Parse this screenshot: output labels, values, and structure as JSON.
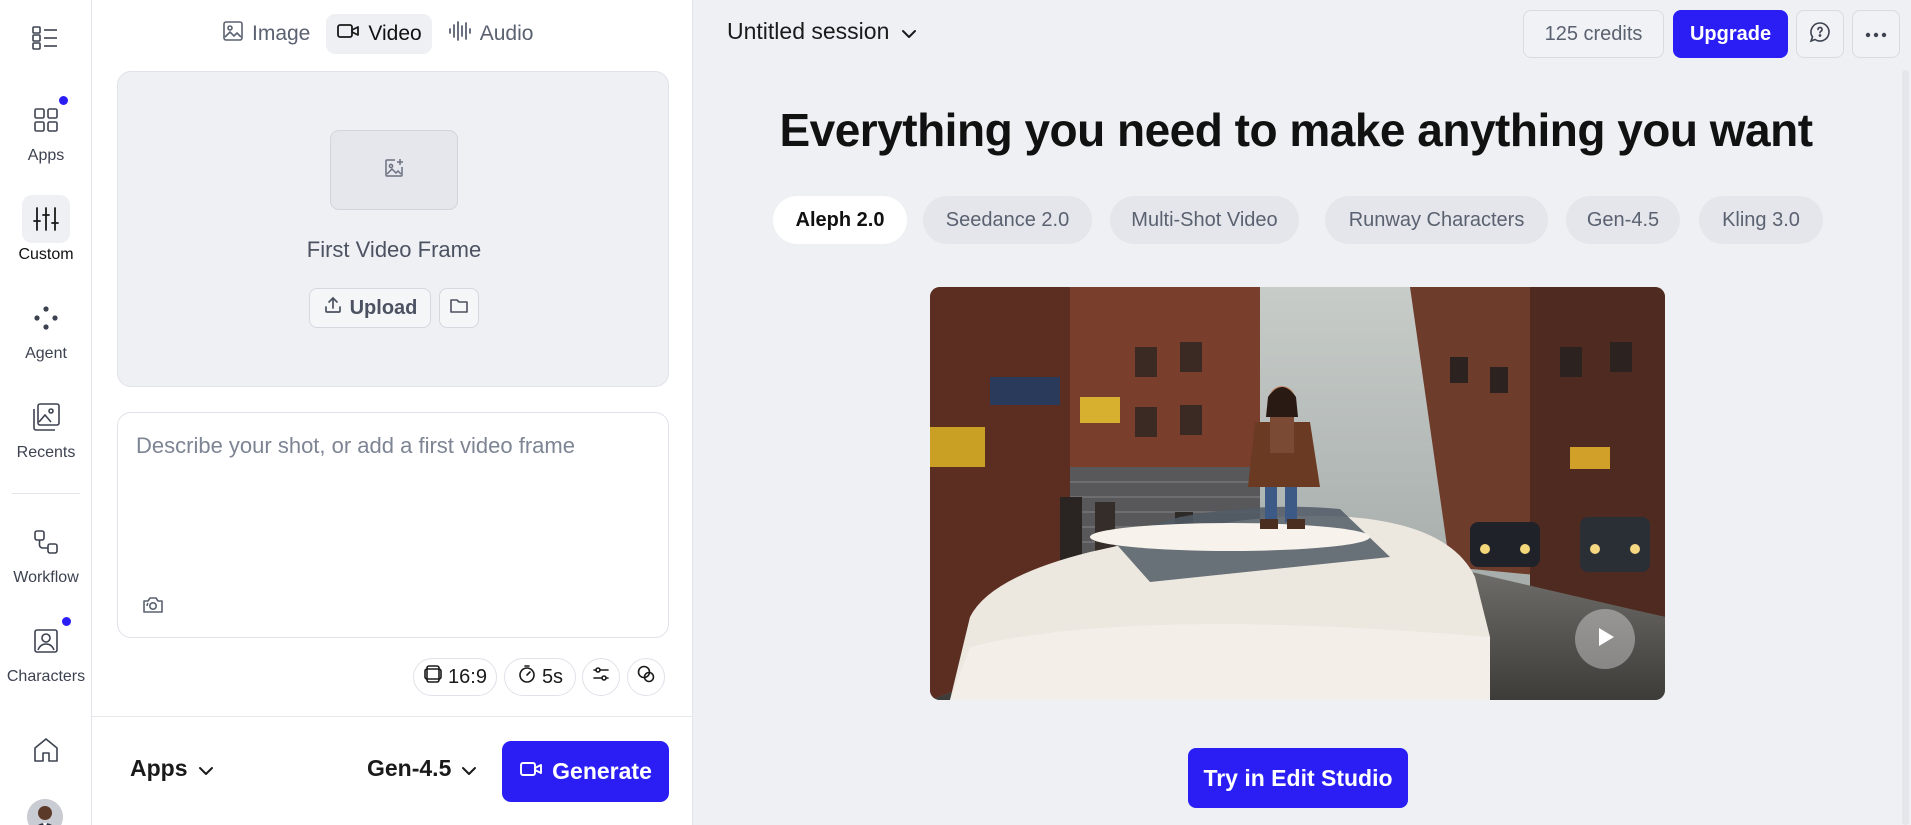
{
  "rail": {
    "items": [
      {
        "label": "Apps",
        "icon": "apps-grid-icon",
        "badge": true
      },
      {
        "label": "Custom",
        "icon": "sliders-icon",
        "active": true
      },
      {
        "label": "Agent",
        "icon": "agent-dots-icon"
      },
      {
        "label": "Recents",
        "icon": "recents-gallery-icon"
      },
      {
        "label": "Workflow",
        "icon": "workflow-icon"
      },
      {
        "label": "Characters",
        "icon": "characters-icon",
        "badge": true
      }
    ]
  },
  "compose": {
    "tabs": [
      {
        "label": "Image",
        "icon": "image-icon"
      },
      {
        "label": "Video",
        "icon": "video-camera-icon",
        "active": true
      },
      {
        "label": "Audio",
        "icon": "audio-wave-icon"
      }
    ],
    "frame_title": "First Video Frame",
    "upload_label": "Upload",
    "prompt_placeholder": "Describe your shot, or add a first video frame",
    "aspect_ratio": "16:9",
    "duration": "5s",
    "apps_label": "Apps",
    "model_label": "Gen-4.5",
    "generate_label": "Generate"
  },
  "header": {
    "session_title": "Untitled session",
    "credits": "125 credits",
    "upgrade_label": "Upgrade"
  },
  "main": {
    "headline": "Everything you need to make anything you want",
    "chips": [
      "Aleph 2.0",
      "Seedance 2.0",
      "Multi-Shot Video",
      "Runway Characters",
      "Gen-4.5",
      "Kling 3.0"
    ],
    "active_chip": "Aleph 2.0",
    "cta_label": "Try in Edit Studio"
  },
  "colors": {
    "accent": "#2a1ef5",
    "page_bg": "#eef0f4"
  }
}
